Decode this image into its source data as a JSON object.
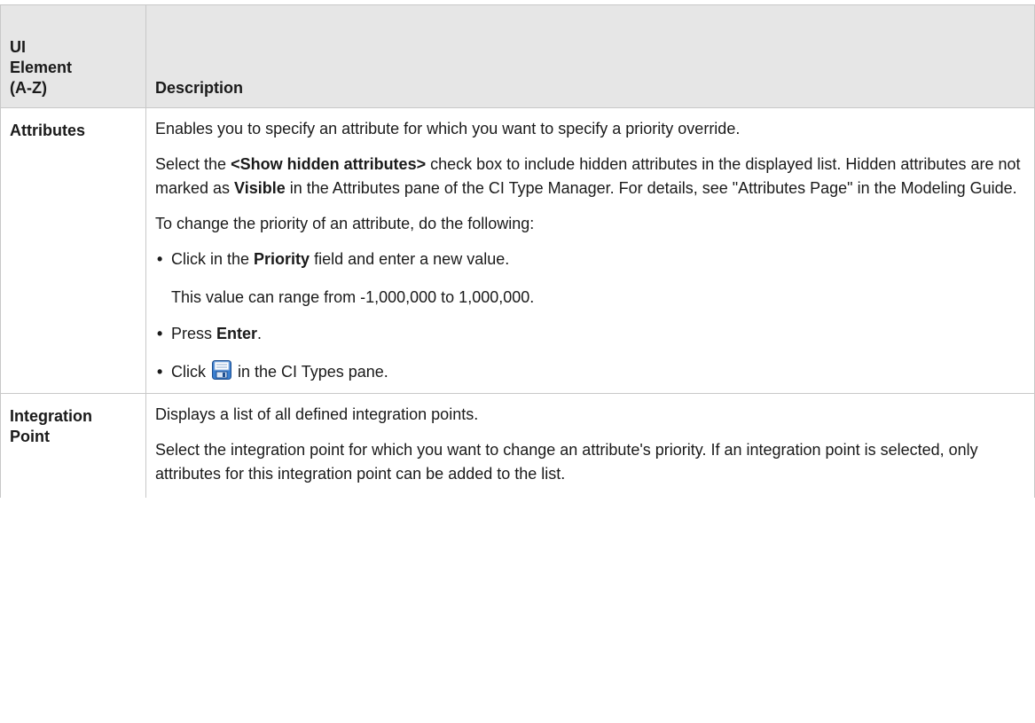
{
  "header": {
    "col1_line1": "UI",
    "col1_line2": "Element",
    "col1_line3": "(A-Z)",
    "col2": "Description"
  },
  "rows": [
    {
      "name": "Attributes",
      "p1": "Enables you to specify an attribute for which you want to specify a priority override.",
      "p2_pre": "Select the ",
      "p2_b1": "<Show hidden attributes>",
      "p2_mid": " check box to include hidden attributes in the displayed list. Hidden attributes are not marked as ",
      "p2_b2": "Visible",
      "p2_post": " in the Attributes pane of the CI Type Manager. For details, see \"Attributes Page\" in the Modeling Guide.",
      "p3": "To change the priority of an attribute, do the following:",
      "steps": {
        "s1_pre": "Click in the ",
        "s1_b": "Priority",
        "s1_post": " field and enter a new value.",
        "s1_note": "This value can range from -1,000,000 to 1,000,000.",
        "s2_pre": "Press ",
        "s2_b": "Enter",
        "s2_post": ".",
        "s3_pre": "Click ",
        "s3_post": " in the CI Types pane.",
        "s3_icon": "save-icon"
      }
    },
    {
      "name_line1": "Integration",
      "name_line2": "Point",
      "p1": "Displays a list of all defined integration points.",
      "p2": "Select the integration point for which you want to change an attribute's priority. If an integration point is selected, only attributes for this integration point can be added to the list."
    }
  ],
  "colors": {
    "header_bg": "#e6e6e6",
    "border": "#c8c8c8",
    "save_icon_blue": "#3a7fd0"
  }
}
